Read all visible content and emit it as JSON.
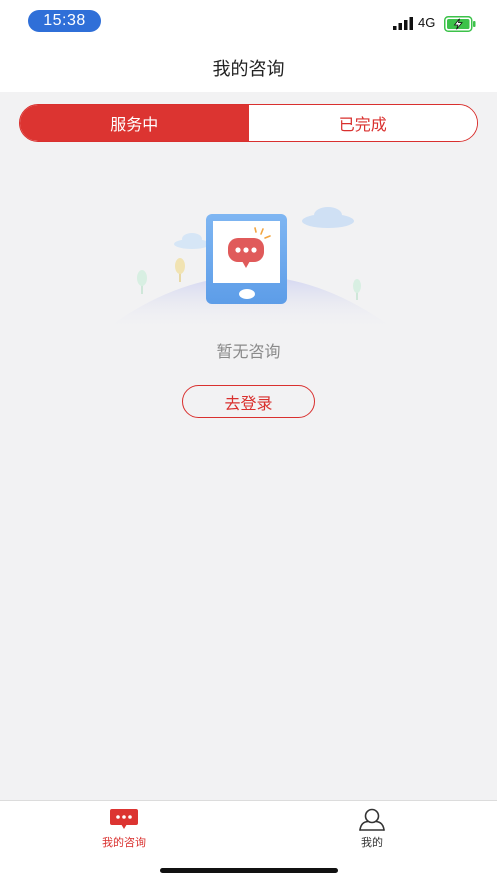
{
  "status_bar": {
    "time": "15:38",
    "network": "4G",
    "time_pill_color": "#2f6fd8",
    "battery_color": "#3cc24a",
    "icons": [
      "signal-icon",
      "battery-charging-icon"
    ]
  },
  "header": {
    "title": "我的咨询"
  },
  "tabs": {
    "items": [
      {
        "label": "服务中",
        "active": true
      },
      {
        "label": "已完成",
        "active": false
      }
    ],
    "accent": "#dc3431"
  },
  "empty_state": {
    "message": "暂无咨询",
    "illustration_icons": [
      "phone-chat-icon",
      "cloud-icon",
      "tree-icon"
    ],
    "login_button": "去登录"
  },
  "tab_bar": {
    "items": [
      {
        "label": "我的咨询",
        "icon": "chat-bubble-icon",
        "active": true
      },
      {
        "label": "我的",
        "icon": "person-icon",
        "active": false
      }
    ]
  }
}
